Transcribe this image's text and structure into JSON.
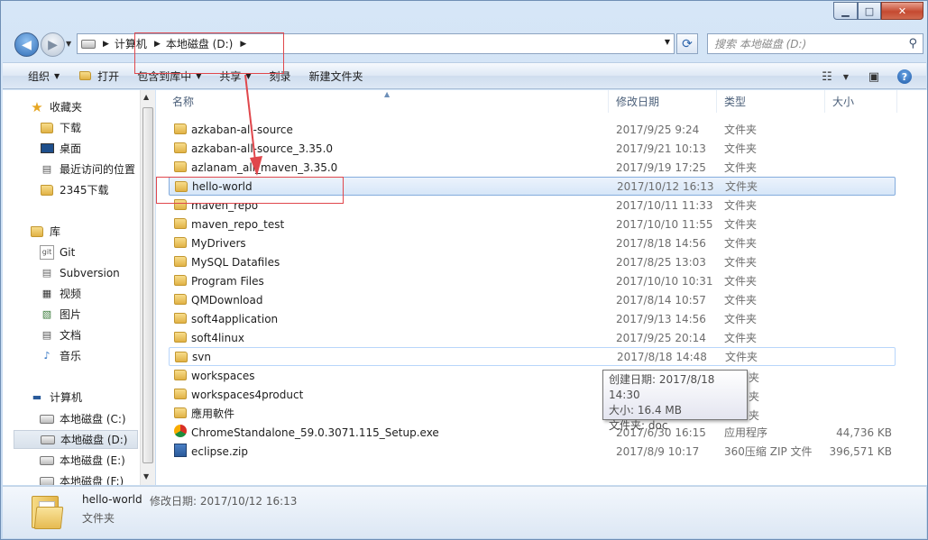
{
  "address": {
    "crumbs": [
      "计算机",
      "本地磁盘 (D:)"
    ]
  },
  "search": {
    "placeholder": "搜索 本地磁盘 (D:)"
  },
  "toolbar": {
    "organize": "组织",
    "open": "打开",
    "include_library": "包含到库中",
    "share": "共享",
    "burn": "刻录",
    "new_folder": "新建文件夹"
  },
  "sidebar": {
    "favorites": "收藏夹",
    "fav_items": [
      "下载",
      "桌面",
      "最近访问的位置",
      "2345下载"
    ],
    "libraries": "库",
    "lib_items": [
      "Git",
      "Subversion",
      "视频",
      "图片",
      "文档",
      "音乐"
    ],
    "computer": "计算机",
    "drives": [
      "本地磁盘 (C:)",
      "本地磁盘 (D:)",
      "本地磁盘 (E:)",
      "本地磁盘 (F:)"
    ]
  },
  "columns": {
    "name": "名称",
    "date": "修改日期",
    "type": "类型",
    "size": "大小"
  },
  "files": [
    {
      "name": "azkaban-all-source",
      "date": "2017/9/25 9:24",
      "type": "文件夹",
      "size": ""
    },
    {
      "name": "azkaban-all-source_3.35.0",
      "date": "2017/9/21 10:13",
      "type": "文件夹",
      "size": ""
    },
    {
      "name": "azlanam_all_maven_3.35.0",
      "date": "2017/9/19 17:25",
      "type": "文件夹",
      "size": ""
    },
    {
      "name": "hello-world",
      "date": "2017/10/12 16:13",
      "type": "文件夹",
      "size": ""
    },
    {
      "name": "maven_repo",
      "date": "2017/10/11 11:33",
      "type": "文件夹",
      "size": ""
    },
    {
      "name": "maven_repo_test",
      "date": "2017/10/10 11:55",
      "type": "文件夹",
      "size": ""
    },
    {
      "name": "MyDrivers",
      "date": "2017/8/18 14:56",
      "type": "文件夹",
      "size": ""
    },
    {
      "name": "MySQL Datafiles",
      "date": "2017/8/25 13:03",
      "type": "文件夹",
      "size": ""
    },
    {
      "name": "Program Files",
      "date": "2017/10/10 10:31",
      "type": "文件夹",
      "size": ""
    },
    {
      "name": "QMDownload",
      "date": "2017/8/14 10:57",
      "type": "文件夹",
      "size": ""
    },
    {
      "name": "soft4application",
      "date": "2017/9/13 14:56",
      "type": "文件夹",
      "size": ""
    },
    {
      "name": "soft4linux",
      "date": "2017/9/25 20:14",
      "type": "文件夹",
      "size": ""
    },
    {
      "name": "svn",
      "date": "2017/8/18 14:48",
      "type": "文件夹",
      "size": ""
    },
    {
      "name": "workspaces",
      "date": "",
      "type": "",
      "size": ""
    },
    {
      "name": "workspaces4product",
      "date": "",
      "type": "",
      "size": ""
    },
    {
      "name": "應用軟件",
      "date": "",
      "type": "",
      "size": ""
    },
    {
      "name": "ChromeStandalone_59.0.3071.115_Setup.exe",
      "date": "2017/6/30 16:15",
      "type": "应用程序",
      "size": "44,736 KB"
    },
    {
      "name": "eclipse.zip",
      "date": "2017/8/9 10:17",
      "type": "360压缩 ZIP 文件",
      "size": "396,571 KB"
    }
  ],
  "tooltip": {
    "created": "创建日期: 2017/8/18 14:30",
    "size": "大小: 16.4 MB",
    "folders": "文件夹: doc",
    "partial_types": [
      "夹",
      "夹",
      "夹"
    ]
  },
  "status": {
    "name": "hello-world",
    "modified": "修改日期: 2017/10/12 16:13",
    "type": "文件夹"
  },
  "colors": {
    "selection": "#d6e6f8",
    "annotation": "#e0474c"
  }
}
